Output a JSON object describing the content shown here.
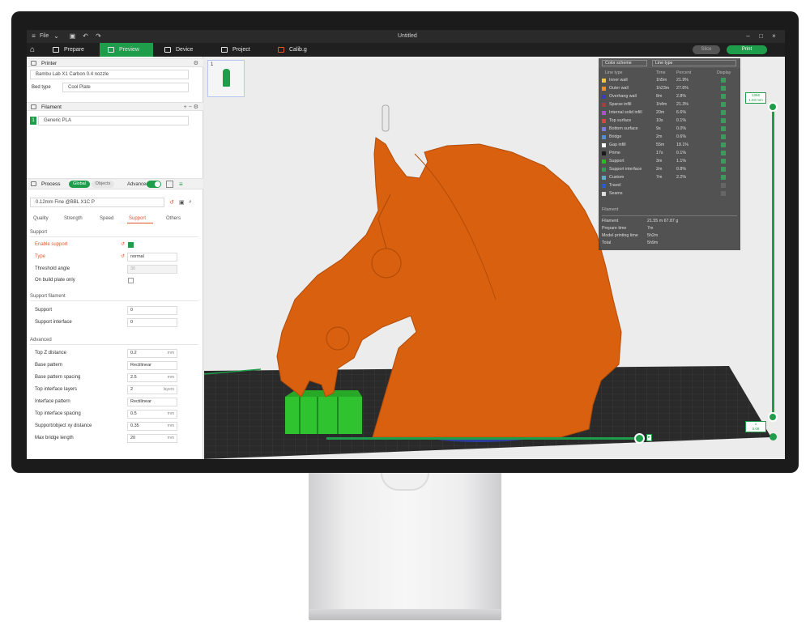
{
  "window": {
    "title": "Untitled",
    "file_menu": "File"
  },
  "nav": {
    "tabs": [
      {
        "label": "Prepare"
      },
      {
        "label": "Preview"
      },
      {
        "label": "Device"
      },
      {
        "label": "Project"
      },
      {
        "label": "Calib.g"
      }
    ],
    "slice_label": "Slice",
    "print_label": "Print"
  },
  "printer": {
    "header": "Printer",
    "model": "Bambu Lab X1 Carbon 0.4 nozzle",
    "bedtype_label": "Bed type",
    "bedtype_value": "Cool Plate"
  },
  "filament": {
    "header": "Filament",
    "slot": "1",
    "name": "Generic PLA"
  },
  "process": {
    "header": "Process",
    "global": "Global",
    "objects": "Objects",
    "advanced": "Advanced",
    "preset": "0.12mm Fine @BBL X1C P",
    "tabs": [
      "Quality",
      "Strength",
      "Speed",
      "Support",
      "Others"
    ]
  },
  "support": {
    "group": "Support",
    "enable_label": "Enable support",
    "type_label": "Type",
    "type_value": "normal",
    "threshold_label": "Threshold angle",
    "threshold_value": "30",
    "onbuild_label": "On build plate only"
  },
  "support_filament": {
    "group": "Support filament",
    "support_label": "Support",
    "support_value": "0",
    "interface_label": "Support interface",
    "interface_value": "0"
  },
  "advanced": {
    "group": "Advanced",
    "rows": [
      {
        "label": "Top Z distance",
        "value": "0.2",
        "unit": "mm"
      },
      {
        "label": "Base pattern",
        "value": "Rectilinear",
        "unit": ""
      },
      {
        "label": "Base pattern spacing",
        "value": "2.5",
        "unit": "mm"
      },
      {
        "label": "Top interface layers",
        "value": "2",
        "unit": "layers"
      },
      {
        "label": "Interface pattern",
        "value": "Rectilinear",
        "unit": ""
      },
      {
        "label": "Top interface spacing",
        "value": "0.5",
        "unit": "mm"
      },
      {
        "label": "Support/object xy distance",
        "value": "0.35",
        "unit": "mm"
      },
      {
        "label": "Max bridge length",
        "value": "20",
        "unit": "mm"
      }
    ]
  },
  "preview": {
    "plate_number": "1"
  },
  "legend": {
    "color_scheme_label": "Color scheme",
    "line_type_label": "Line type",
    "col_line_type": "Line type",
    "col_time": "Time",
    "col_percent": "Percent",
    "col_display": "Display",
    "rows": [
      {
        "name": "Inner wall",
        "time": "1h5m",
        "percent": "21.9%",
        "color": "#f2c92b",
        "display": true
      },
      {
        "name": "Outer wall",
        "time": "1h23m",
        "percent": "27.6%",
        "color": "#ff8c1a",
        "display": true
      },
      {
        "name": "Overhang wall",
        "time": "8m",
        "percent": "2.8%",
        "color": "#3b3bc4",
        "display": true
      },
      {
        "name": "Sparse infill",
        "time": "1h4m",
        "percent": "21.3%",
        "color": "#a63f3f",
        "display": true
      },
      {
        "name": "Internal solid infill",
        "time": "20m",
        "percent": "6.6%",
        "color": "#b04fcf",
        "display": true
      },
      {
        "name": "Top surface",
        "time": "10s",
        "percent": "0.1%",
        "color": "#e04040",
        "display": true
      },
      {
        "name": "Bottom surface",
        "time": "9s",
        "percent": "0.0%",
        "color": "#7a7ae0",
        "display": true
      },
      {
        "name": "Bridge",
        "time": "2m",
        "percent": "0.6%",
        "color": "#4f8fd6",
        "display": true
      },
      {
        "name": "Gap infill",
        "time": "55m",
        "percent": "18.1%",
        "color": "#ffffff",
        "display": true
      },
      {
        "name": "Prime",
        "time": "17s",
        "percent": "0.1%",
        "color": "#1a1a1a",
        "display": true
      },
      {
        "name": "Support",
        "time": "3m",
        "percent": "1.1%",
        "color": "#20c020",
        "display": true
      },
      {
        "name": "Support interface",
        "time": "2m",
        "percent": "0.8%",
        "color": "#2f9e5a",
        "display": true
      },
      {
        "name": "Custom",
        "time": "7m",
        "percent": "2.2%",
        "color": "#5ab0c8",
        "display": true
      },
      {
        "name": "Travel",
        "time": "",
        "percent": "",
        "color": "#2a5ad8",
        "display": false
      },
      {
        "name": "Seams",
        "time": "",
        "percent": "",
        "color": "#dddddd",
        "display": false
      }
    ],
    "filament_section": "Filament",
    "stats": [
      {
        "label": "Filament",
        "value": "21.55 m    67.87 g"
      },
      {
        "label": "Prepare time",
        "value": "7m"
      },
      {
        "label": "Model printing time",
        "value": "5h2m"
      },
      {
        "label": "Total",
        "value": "5h9m"
      }
    ]
  },
  "layers": {
    "top": "1356\n1.03 mm",
    "bottom": "1\n0.08"
  },
  "colors": {
    "accent": "#1e9e4a",
    "model": "#d9600f",
    "support": "#2fc42f",
    "bed": "#2b2b2b"
  }
}
